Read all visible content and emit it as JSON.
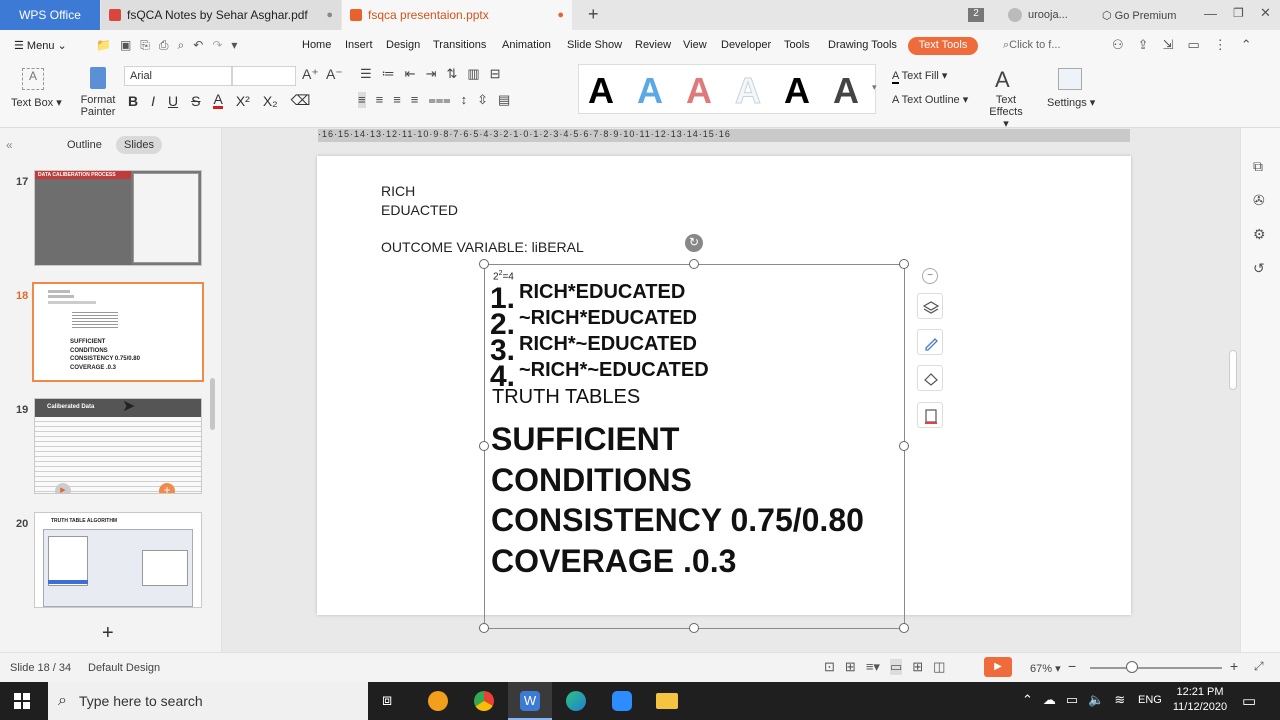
{
  "titlebar": {
    "app_tab": "WPS Office",
    "tabs": [
      {
        "label": "fsQCA Notes by Sehar Asghar.pdf"
      },
      {
        "label": "fsqca presentaion.pptx"
      }
    ],
    "new_tab": "+",
    "badge": "2",
    "user": "urooja...",
    "go_premium": "Go Premium"
  },
  "menu": {
    "menu_label": "Menu",
    "items": [
      "Home",
      "Insert",
      "Design",
      "Transitions",
      "Animation",
      "Slide Show",
      "Review",
      "View",
      "Developer",
      "Tools",
      "Drawing Tools",
      "Text Tools"
    ],
    "search_placeholder": "Click to f..."
  },
  "ribbon": {
    "text_box": "Text Box",
    "format_painter": "Format Painter",
    "font_name": "Arial",
    "font_size": "",
    "text_fill": "Text Fill",
    "text_outline": "Text Outline",
    "text_effects": "Text Effects",
    "settings": "Settings",
    "style_glyph": "A",
    "styles": [
      "#000000",
      "#5aa9e6",
      "#e07a7a",
      "#dfe7ef",
      "#000000",
      "#444444"
    ]
  },
  "left_panel": {
    "tab_outline": "Outline",
    "tab_slides": "Slides",
    "thumbs": [
      {
        "num": "17",
        "title": "DATA CALIBERATION PROCESS"
      },
      {
        "num": "18",
        "title": ""
      },
      {
        "num": "19",
        "title": "Caliberated Data"
      },
      {
        "num": "20",
        "title": "TRUTH TABLE ALGORITHM"
      }
    ],
    "add": "+"
  },
  "ruler": "·16·15·14·13·12·11·10·9·8·7·6·5·4·3·2·1·0·1·2·3·4·5·6·7·8·9·10·11·12·13·14·15·16",
  "slide": {
    "line1": "RICH",
    "line2": "EDUACTED",
    "outcome": "OUTCOME VARIABLE: liBERAL",
    "formula_base": "2",
    "formula_exp": "2",
    "formula_rest": "=4",
    "items": [
      {
        "num": "1.",
        "text": "RICH*EDUCATED"
      },
      {
        "num": "2.",
        "text": "~RICH*EDUCATED"
      },
      {
        "num": "3.",
        "text": "RICH*~EDUCATED"
      },
      {
        "num": "4.",
        "text": "~RICH*~EDUCATED"
      }
    ],
    "truth_tables": "TRUTH TABLES",
    "big_lines": [
      "SUFFICIENT",
      "CONDITIONS",
      "CONSISTENCY 0.75/0.80",
      "COVERAGE .0.3"
    ]
  },
  "status": {
    "slide_info": "Slide 18 / 34",
    "design": "Default Design",
    "zoom": "67%"
  },
  "taskbar": {
    "search_placeholder": "Type here to search",
    "language": "ENG",
    "time": "12:21 PM",
    "date": "11/12/2020"
  }
}
